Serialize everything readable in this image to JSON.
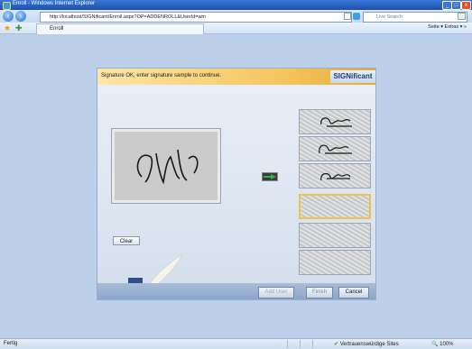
{
  "window": {
    "title": "Enroll - Windows Internet Explorer",
    "controls": {
      "minimize": "_",
      "maximize": "□",
      "close": "x"
    }
  },
  "addressbar": {
    "url": "http://localhost/SIGNificant/Enroll.aspx?OP=ADDENROLL&UserId=wm",
    "search_placeholder": "Live Search",
    "back_icon": "back-arrow-icon",
    "forward_icon": "forward-arrow-icon"
  },
  "tabbar": {
    "tab_label": "Enroll",
    "tools": "Seite ▾  Extras ▾  »"
  },
  "dialog": {
    "instruction": "Signature OK, enter signature sample to continue.",
    "brand": "SIGNificant",
    "clear_label": "Clear",
    "add_user_label": "Add User",
    "finish_label": "Finish",
    "cancel_label": "Cancel",
    "slots": [
      {
        "filled": true,
        "selected": false
      },
      {
        "filled": true,
        "selected": false
      },
      {
        "filled": true,
        "selected": false
      },
      {
        "filled": false,
        "selected": true
      },
      {
        "filled": false,
        "selected": false
      },
      {
        "filled": false,
        "selected": false
      }
    ],
    "accent_color": "#f0c24a",
    "arrow_color": "#2bb34a"
  },
  "statusbar": {
    "left": "Fertig",
    "zone": "Vertrauenswürdige Sites",
    "zoom": "100%"
  }
}
